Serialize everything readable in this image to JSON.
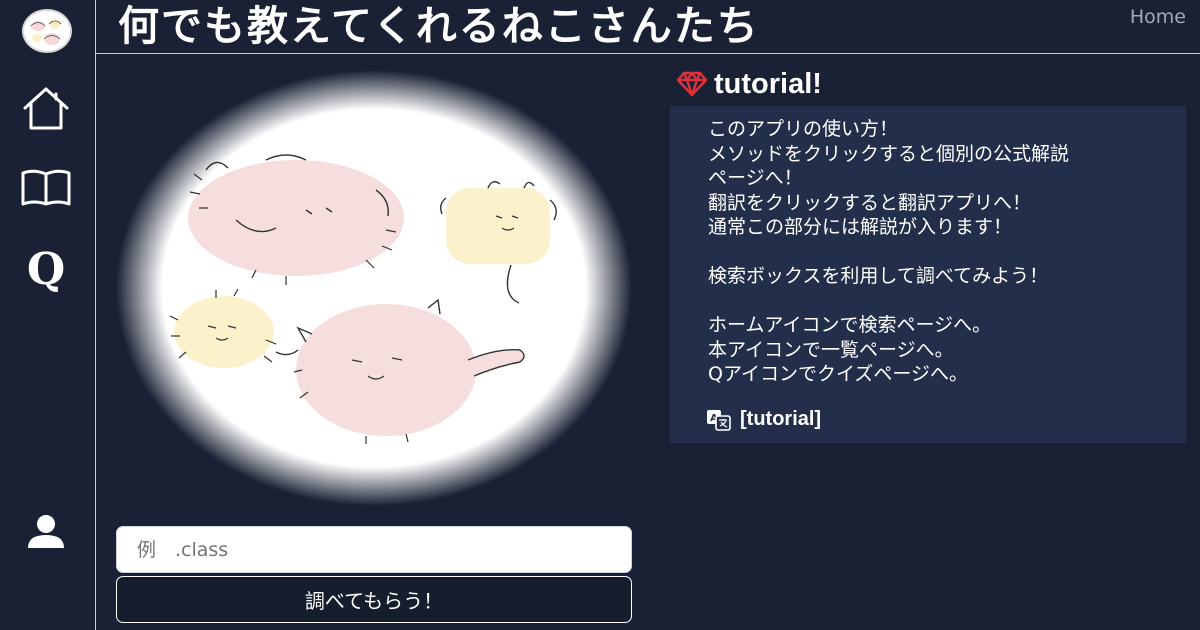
{
  "header": {
    "title": "何でも教えてくれるねこさんたち",
    "home_link": "Home"
  },
  "sidebar": {
    "items": [
      {
        "icon": "home-icon"
      },
      {
        "icon": "book-icon"
      },
      {
        "icon": "quiz-icon",
        "glyph": "Q"
      },
      {
        "icon": "user-icon"
      }
    ]
  },
  "search": {
    "placeholder": "例　.class",
    "button_label": "調べてもらう！"
  },
  "tutorial": {
    "icon": "gem-icon",
    "title": "tutorial!",
    "lines": [
      "このアプリの使い方！",
      "メソッドをクリックすると個別の公式解説",
      "ページへ！",
      "翻訳をクリックすると翻訳アプリへ！",
      "通常この部分には解説が入ります！",
      "",
      "検索ボックスを利用して調べてみよう！",
      "",
      "ホームアイコンで検索ページへ。",
      "本アイコンで一覧ページへ。",
      "Qアイコンでクイズページへ。"
    ],
    "translate_icon": "translate-icon",
    "translate_label": "[tutorial]"
  },
  "colors": {
    "background": "#1a2134",
    "panel": "#232f4a",
    "gem": "#e0313a"
  }
}
